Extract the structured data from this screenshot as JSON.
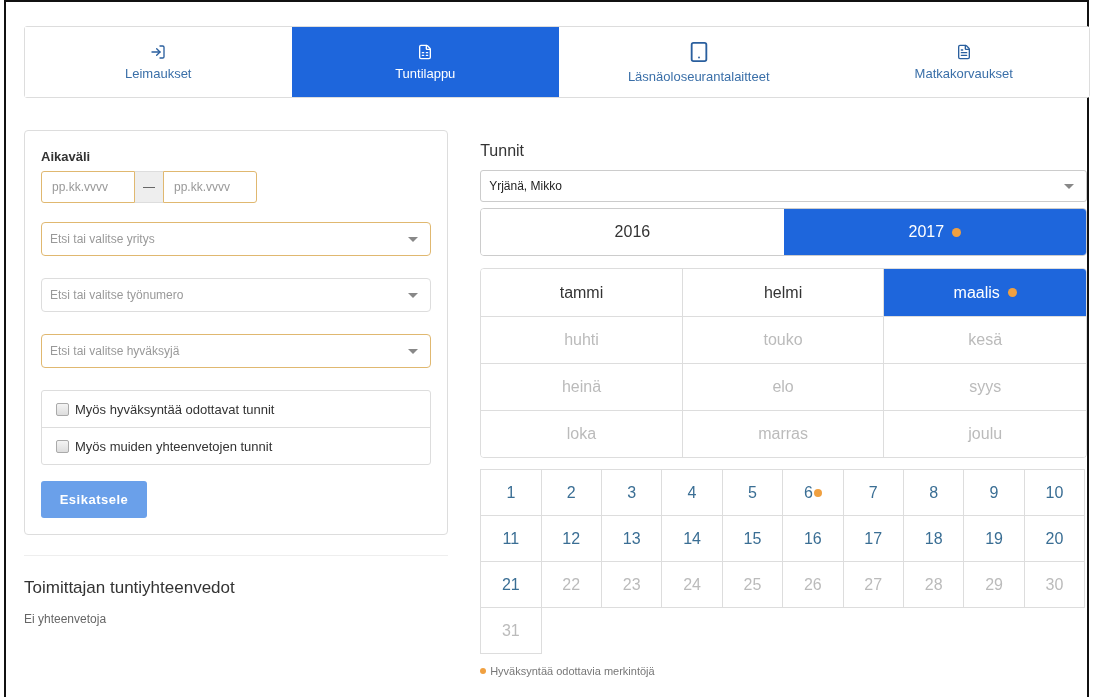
{
  "tabs": [
    {
      "label": "Leimaukset",
      "selected": false
    },
    {
      "label": "Tuntilappu",
      "selected": true
    },
    {
      "label": "Läsnäoloseurantalaitteet",
      "selected": false
    },
    {
      "label": "Matkakorvaukset",
      "selected": false
    }
  ],
  "filter": {
    "title": "Aikaväli",
    "date_from": {
      "placeholder": "pp.kk.vvvv"
    },
    "separator": "—",
    "date_to": {
      "placeholder": "pp.kk.vvvv"
    },
    "selects": [
      {
        "placeholder": "Etsi tai valitse yritys",
        "highlighted": true
      },
      {
        "placeholder": "Etsi tai valitse työnumero",
        "highlighted": false
      },
      {
        "placeholder": "Etsi tai valitse hyväksyjä",
        "highlighted": true
      }
    ],
    "checkboxes": [
      {
        "label": "Myös hyväksyntää odottavat tunnit",
        "checked": false
      },
      {
        "label": "Myös muiden yhteenvetojen tunnit",
        "checked": false
      }
    ],
    "button": "Esikatsele"
  },
  "summaries": {
    "title": "Toimittajan tuntiyhteenvedot",
    "empty_text": "Ei yhteenvetoja"
  },
  "hours": {
    "title": "Tunnit",
    "person_select": {
      "value": "Yrjänä, Mikko"
    },
    "years": [
      {
        "label": "2016",
        "selected": false,
        "pending": false
      },
      {
        "label": "2017",
        "selected": true,
        "pending": true
      }
    ],
    "months": [
      {
        "label": "tammi",
        "selected": false,
        "disabled": false,
        "pending": false
      },
      {
        "label": "helmi",
        "selected": false,
        "disabled": false,
        "pending": false
      },
      {
        "label": "maalis",
        "selected": true,
        "disabled": false,
        "pending": true
      },
      {
        "label": "huhti",
        "selected": false,
        "disabled": true,
        "pending": false
      },
      {
        "label": "touko",
        "selected": false,
        "disabled": true,
        "pending": false
      },
      {
        "label": "kesä",
        "selected": false,
        "disabled": true,
        "pending": false
      },
      {
        "label": "heinä",
        "selected": false,
        "disabled": true,
        "pending": false
      },
      {
        "label": "elo",
        "selected": false,
        "disabled": true,
        "pending": false
      },
      {
        "label": "syys",
        "selected": false,
        "disabled": true,
        "pending": false
      },
      {
        "label": "loka",
        "selected": false,
        "disabled": true,
        "pending": false
      },
      {
        "label": "marras",
        "selected": false,
        "disabled": true,
        "pending": false
      },
      {
        "label": "joulu",
        "selected": false,
        "disabled": true,
        "pending": false
      }
    ],
    "days": [
      {
        "label": "1",
        "disabled": false,
        "pending": false
      },
      {
        "label": "2",
        "disabled": false,
        "pending": false
      },
      {
        "label": "3",
        "disabled": false,
        "pending": false
      },
      {
        "label": "4",
        "disabled": false,
        "pending": false
      },
      {
        "label": "5",
        "disabled": false,
        "pending": false
      },
      {
        "label": "6",
        "disabled": false,
        "pending": true
      },
      {
        "label": "7",
        "disabled": false,
        "pending": false
      },
      {
        "label": "8",
        "disabled": false,
        "pending": false
      },
      {
        "label": "9",
        "disabled": false,
        "pending": false
      },
      {
        "label": "10",
        "disabled": false,
        "pending": false
      },
      {
        "label": "11",
        "disabled": false,
        "pending": false
      },
      {
        "label": "12",
        "disabled": false,
        "pending": false
      },
      {
        "label": "13",
        "disabled": false,
        "pending": false
      },
      {
        "label": "14",
        "disabled": false,
        "pending": false
      },
      {
        "label": "15",
        "disabled": false,
        "pending": false
      },
      {
        "label": "16",
        "disabled": false,
        "pending": false
      },
      {
        "label": "17",
        "disabled": false,
        "pending": false
      },
      {
        "label": "18",
        "disabled": false,
        "pending": false
      },
      {
        "label": "19",
        "disabled": false,
        "pending": false
      },
      {
        "label": "20",
        "disabled": false,
        "pending": false
      },
      {
        "label": "21",
        "disabled": false,
        "pending": false
      },
      {
        "label": "22",
        "disabled": true,
        "pending": false
      },
      {
        "label": "23",
        "disabled": true,
        "pending": false
      },
      {
        "label": "24",
        "disabled": true,
        "pending": false
      },
      {
        "label": "25",
        "disabled": true,
        "pending": false
      },
      {
        "label": "26",
        "disabled": true,
        "pending": false
      },
      {
        "label": "27",
        "disabled": true,
        "pending": false
      },
      {
        "label": "28",
        "disabled": true,
        "pending": false
      },
      {
        "label": "29",
        "disabled": true,
        "pending": false
      },
      {
        "label": "30",
        "disabled": true,
        "pending": false
      },
      {
        "label": "31",
        "disabled": true,
        "pending": false
      }
    ],
    "legend": "Hyväksyntää odottavia merkintöjä"
  }
}
